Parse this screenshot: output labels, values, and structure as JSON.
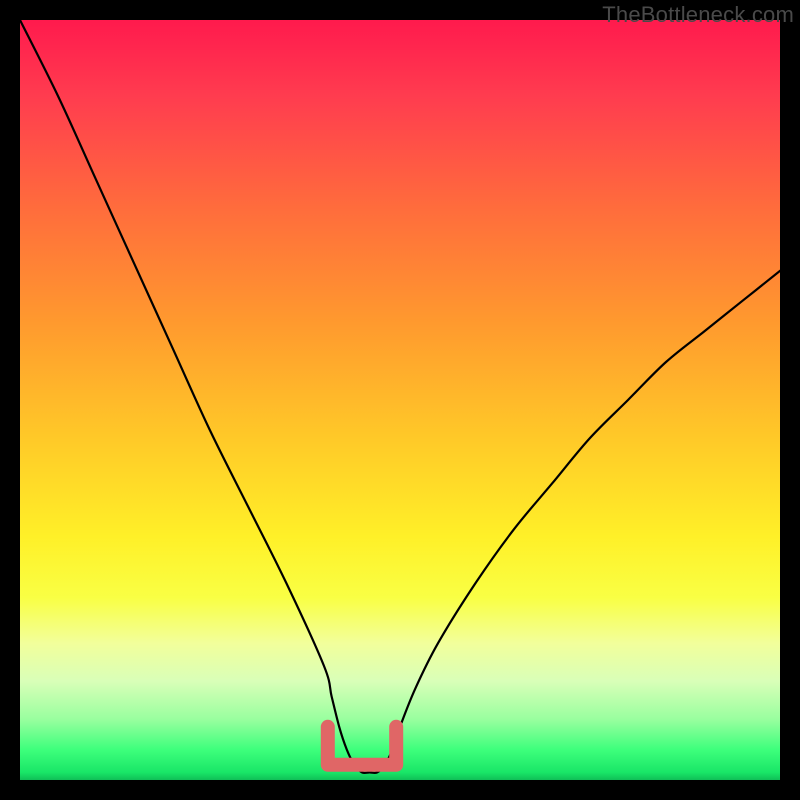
{
  "watermark": "TheBottleneck.com",
  "chart_data": {
    "type": "line",
    "title": "",
    "xlabel": "",
    "ylabel": "",
    "xlim": [
      0,
      100
    ],
    "ylim": [
      0,
      100
    ],
    "series": [
      {
        "name": "bottleneck-curve",
        "x": [
          0,
          5,
          10,
          15,
          20,
          25,
          30,
          35,
          40,
          41,
          42,
          43,
          44,
          45,
          46,
          47,
          48,
          49,
          50,
          52,
          55,
          60,
          65,
          70,
          75,
          80,
          85,
          90,
          95,
          100
        ],
        "values": [
          100,
          90,
          79,
          68,
          57,
          46,
          36,
          26,
          15,
          11,
          7,
          4,
          2,
          1,
          1,
          1,
          2,
          4,
          7,
          12,
          18,
          26,
          33,
          39,
          45,
          50,
          55,
          59,
          63,
          67
        ]
      }
    ],
    "highlight": {
      "name": "flat-min-region",
      "x_range": [
        40.5,
        49.5
      ],
      "y_level": 2
    }
  }
}
